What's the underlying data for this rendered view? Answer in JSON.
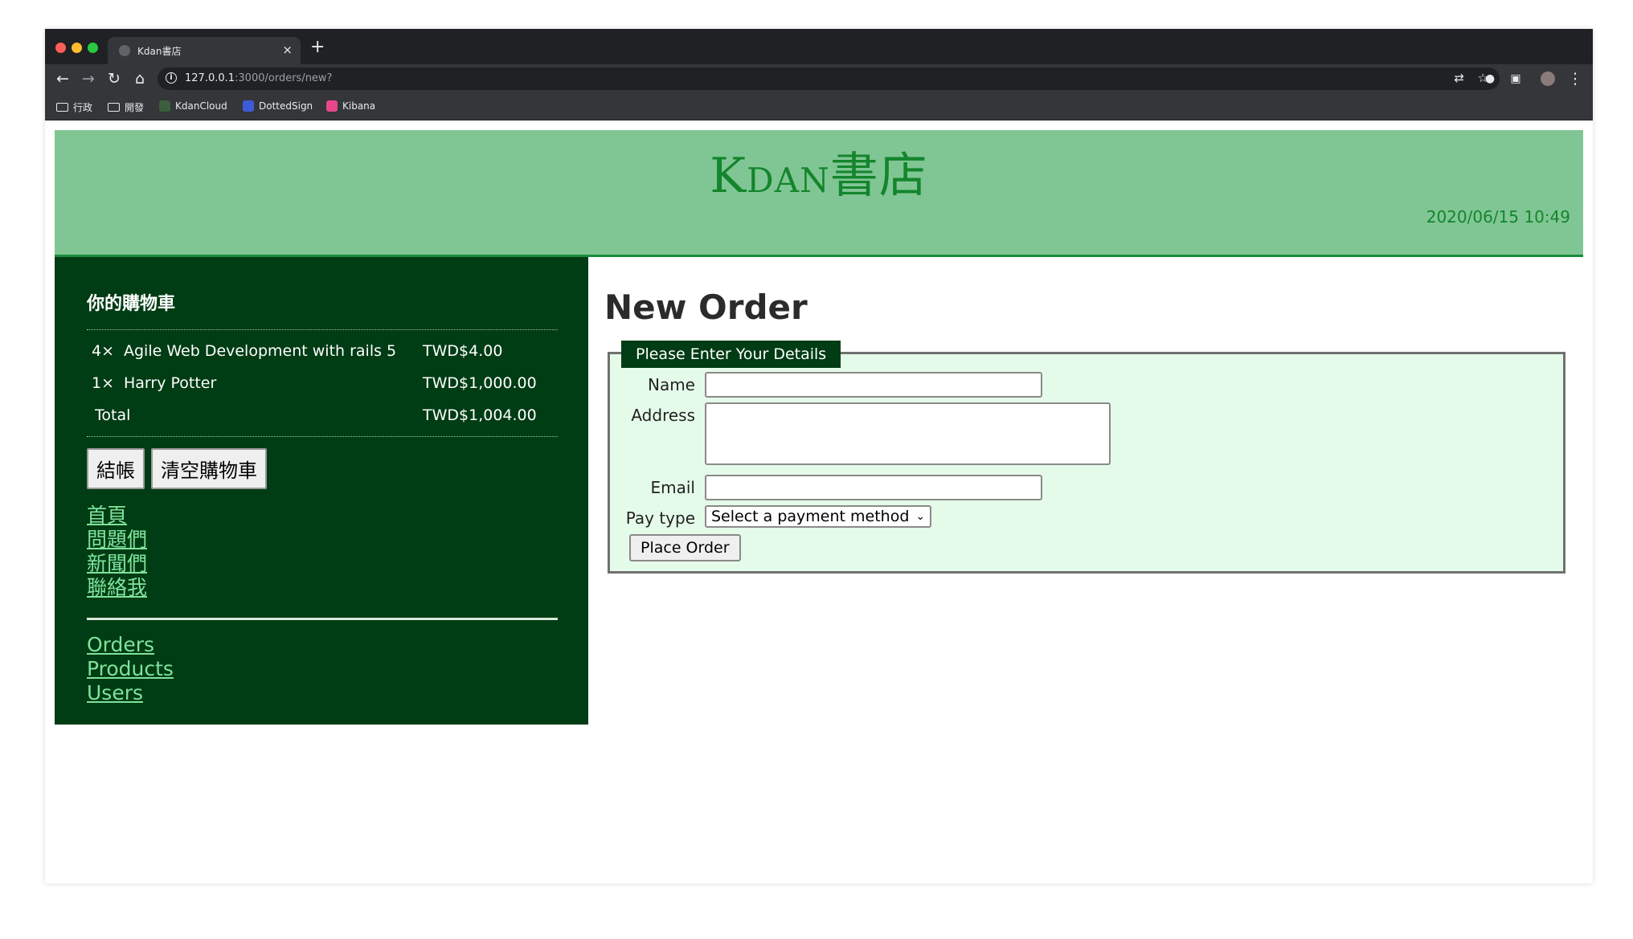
{
  "browser": {
    "tab_title": "Kdan書店",
    "tab_close": "×",
    "new_tab": "+",
    "url_host": "127.0.0.1",
    "url_path": ":3000/orders/new?",
    "bookmarks": [
      {
        "label": "行政",
        "icon": "folder-icon"
      },
      {
        "label": "開發",
        "icon": "folder-icon"
      },
      {
        "label": "KdanCloud",
        "icon": "kdancloud-icon"
      },
      {
        "label": "DottedSign",
        "icon": "dottedsign-icon"
      },
      {
        "label": "Kibana",
        "icon": "kibana-icon"
      }
    ]
  },
  "header": {
    "title": "Kdan書店",
    "datetime": "2020/06/15 10:49"
  },
  "sidebar": {
    "cart_heading": "你的購物車",
    "items": [
      {
        "qty": "4×",
        "title": "Agile Web Development with rails 5",
        "price": "TWD$4.00"
      },
      {
        "qty": "1×",
        "title": "Harry Potter",
        "price": "TWD$1,000.00"
      }
    ],
    "total_label": "Total",
    "total_price": "TWD$1,004.00",
    "checkout_button": "結帳",
    "empty_cart_button": "清空購物車",
    "nav_links": [
      "首頁",
      "問題們",
      "新聞們",
      "聯絡我"
    ],
    "admin_links": [
      "Orders",
      "Products",
      "Users"
    ]
  },
  "main": {
    "page_title": "New Order",
    "legend": "Please Enter Your Details",
    "name_label": "Name",
    "address_label": "Address",
    "email_label": "Email",
    "pay_type_label": "Pay type",
    "pay_type_selected": "Select a payment method",
    "submit_button": "Place Order"
  },
  "colors": {
    "banner_bg": "#80c694",
    "banner_text": "#14852c",
    "sidebar_bg": "#003c14",
    "sidebar_link": "#7fe39b",
    "form_bg": "#e5fbe9"
  }
}
